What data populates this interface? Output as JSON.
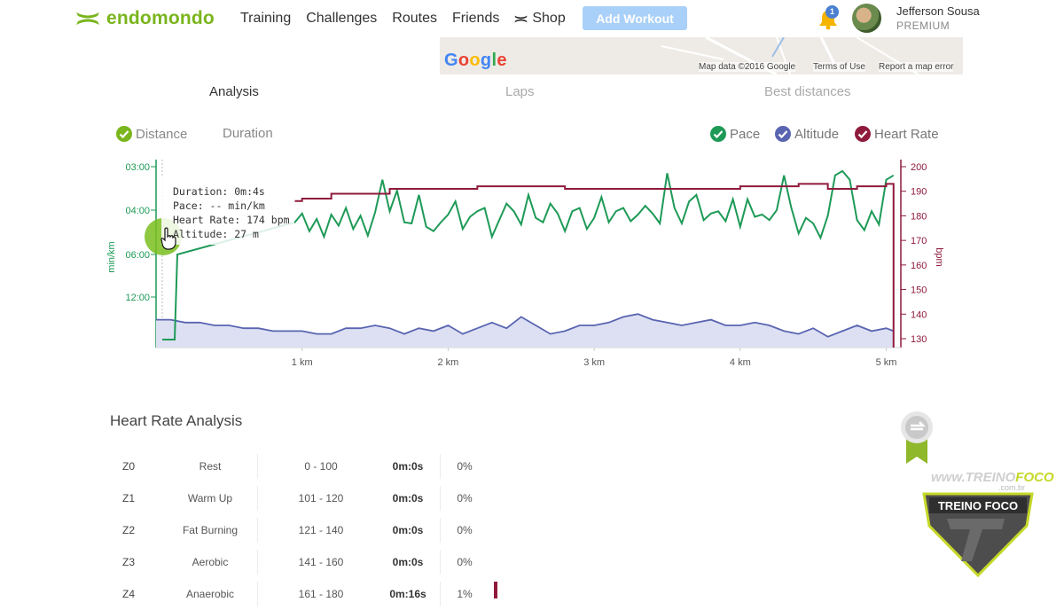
{
  "app": {
    "brand": "endomondo",
    "brand_color": "#7ab51d",
    "nav": [
      {
        "label": "Training"
      },
      {
        "label": "Challenges"
      },
      {
        "label": "Routes"
      },
      {
        "label": "Friends"
      },
      {
        "label": "Shop",
        "icon": "underarmour-logo-icon"
      }
    ],
    "add_workout": "Add Workout",
    "notifications_count": "1",
    "user": {
      "name": "Jefferson Sousa",
      "plan": "PREMIUM"
    }
  },
  "map": {
    "logo": "Google",
    "data_text": "Map data ©2016 Google",
    "terms": "Terms of Use",
    "report": "Report a map error"
  },
  "tabs": [
    {
      "label": "Analysis",
      "active": true
    },
    {
      "label": "Laps",
      "active": false
    },
    {
      "label": "Best distances",
      "active": false
    }
  ],
  "x_toggle": {
    "distance": "Distance",
    "duration": "Duration"
  },
  "series_toggle": {
    "pace": "Pace",
    "altitude": "Altitude",
    "heart_rate": "Heart Rate"
  },
  "colors": {
    "pace": "#1e9a57",
    "altitude": "#5965b0",
    "altitude_fill": "#dde0f3",
    "heart_rate": "#8f1b3c"
  },
  "tooltip": {
    "duration": "Duration: 0m:4s",
    "pace": "Pace: -- min/km",
    "heart_rate": "Heart Rate: 174 bpm",
    "altitude": "Altitude: 27 m"
  },
  "chart_data": {
    "type": "line",
    "x_unit": "km",
    "x_ticks": [
      "1 km",
      "2 km",
      "3 km",
      "4 km",
      "5 km"
    ],
    "xlim": [
      0,
      5.1
    ],
    "left_axis": {
      "label": "min/km",
      "ticks": [
        "03:00",
        "04:00",
        "06:00",
        "12:00"
      ]
    },
    "right_axis": {
      "label": "bpm",
      "ticks": [
        "200",
        "190",
        "180",
        "170",
        "160",
        "150",
        "140",
        "130"
      ],
      "ylim": [
        127,
        200
      ]
    },
    "series": [
      {
        "name": "Heart Rate",
        "x": [
          0.95,
          1.0,
          1.1,
          1.2,
          1.4,
          1.6,
          1.8,
          2.0,
          2.2,
          2.4,
          2.6,
          2.8,
          3.0,
          3.2,
          3.4,
          3.6,
          3.8,
          4.0,
          4.2,
          4.4,
          4.6,
          4.8,
          5.0,
          5.05
        ],
        "values": [
          186,
          187,
          187,
          189,
          189,
          191,
          191,
          191,
          192,
          192,
          192,
          191,
          191,
          191,
          191,
          191,
          191,
          192,
          192,
          193,
          191,
          192,
          193,
          193
        ]
      },
      {
        "name": "Pace",
        "x": [
          0.95,
          1.0,
          1.05,
          1.1,
          1.15,
          1.2,
          1.25,
          1.3,
          1.35,
          1.4,
          1.45,
          1.5,
          1.55,
          1.6,
          1.65,
          1.7,
          1.75,
          1.8,
          1.85,
          1.9,
          1.95,
          2.0,
          2.05,
          2.1,
          2.15,
          2.2,
          2.25,
          2.3,
          2.35,
          2.4,
          2.45,
          2.5,
          2.55,
          2.6,
          2.65,
          2.7,
          2.75,
          2.8,
          2.85,
          2.9,
          2.95,
          3.0,
          3.05,
          3.1,
          3.15,
          3.2,
          3.25,
          3.3,
          3.35,
          3.4,
          3.45,
          3.5,
          3.55,
          3.6,
          3.65,
          3.7,
          3.75,
          3.8,
          3.85,
          3.9,
          3.95,
          4.0,
          4.05,
          4.1,
          4.15,
          4.2,
          4.25,
          4.3,
          4.35,
          4.4,
          4.45,
          4.5,
          4.55,
          4.6,
          4.65,
          4.7,
          4.75,
          4.8,
          4.85,
          4.9,
          4.95,
          5.0,
          5.05
        ],
        "pace_min_per_km": [
          4.55,
          4.15,
          4.95,
          4.4,
          5.2,
          4.2,
          4.7,
          3.95,
          4.85,
          4.25,
          5.15,
          4.1,
          3.3,
          4.05,
          3.55,
          4.55,
          4.6,
          3.65,
          4.75,
          4.95,
          4.55,
          4.2,
          3.8,
          4.85,
          4.3,
          4.05,
          3.95,
          5.2,
          4.45,
          3.85,
          4.05,
          4.65,
          3.65,
          4.35,
          4.55,
          3.85,
          4.15,
          4.95,
          4.05,
          3.95,
          4.85,
          4.35,
          3.7,
          4.55,
          4.05,
          3.95,
          4.5,
          4.2,
          3.9,
          4.15,
          4.6,
          3.15,
          3.95,
          4.6,
          3.8,
          3.65,
          4.45,
          4.15,
          4.05,
          4.5,
          3.75,
          4.75,
          3.75,
          4.3,
          4.2,
          4.45,
          4.0,
          3.2,
          3.95,
          5.05,
          4.35,
          4.6,
          5.25,
          4.25,
          3.2,
          3.1,
          3.3,
          4.45,
          4.9,
          4.05,
          4.65,
          3.3,
          3.2
        ]
      },
      {
        "name": "Altitude",
        "x": [
          0.0,
          0.1,
          0.2,
          0.3,
          0.4,
          0.5,
          0.6,
          0.7,
          0.8,
          0.9,
          1.0,
          1.1,
          1.2,
          1.3,
          1.4,
          1.5,
          1.6,
          1.7,
          1.8,
          1.9,
          2.0,
          2.1,
          2.2,
          2.3,
          2.4,
          2.5,
          2.6,
          2.7,
          2.8,
          2.9,
          3.0,
          3.1,
          3.2,
          3.3,
          3.4,
          3.5,
          3.6,
          3.7,
          3.8,
          3.9,
          4.0,
          4.1,
          4.2,
          4.3,
          4.4,
          4.5,
          4.6,
          4.7,
          4.8,
          4.9,
          5.0,
          5.05
        ],
        "altitude_m": [
          27,
          27,
          26,
          26,
          25,
          25,
          24,
          24,
          23,
          23,
          23,
          22,
          22,
          24,
          24,
          25,
          24,
          22,
          24,
          23,
          25,
          22,
          24,
          26,
          24,
          28,
          25,
          22,
          23,
          25,
          25,
          26,
          28,
          29,
          27,
          26,
          25,
          26,
          27,
          25,
          25,
          26,
          25,
          23,
          22,
          24,
          21,
          23,
          25,
          23,
          24,
          23
        ]
      }
    ]
  },
  "hr_analysis": {
    "title": "Heart Rate Analysis",
    "rows": [
      {
        "zone": "Z0",
        "name": "Rest",
        "range": "0 - 100",
        "time": "0m:0s",
        "pct": "0%",
        "share": 0
      },
      {
        "zone": "Z1",
        "name": "Warm Up",
        "range": "101 - 120",
        "time": "0m:0s",
        "pct": "0%",
        "share": 0
      },
      {
        "zone": "Z2",
        "name": "Fat Burning",
        "range": "121 - 140",
        "time": "0m:0s",
        "pct": "0%",
        "share": 0
      },
      {
        "zone": "Z3",
        "name": "Aerobic",
        "range": "141 - 160",
        "time": "0m:0s",
        "pct": "0%",
        "share": 0
      },
      {
        "zone": "Z4",
        "name": "Anaerobic",
        "range": "161 - 180",
        "time": "0m:16s",
        "pct": "1%",
        "share": 1
      }
    ]
  },
  "watermark": {
    "www": "www.",
    "treino": "TREINO",
    "foco": "FOCO",
    "domain": ".com.br",
    "shield_text": "TREINO FOCO"
  }
}
